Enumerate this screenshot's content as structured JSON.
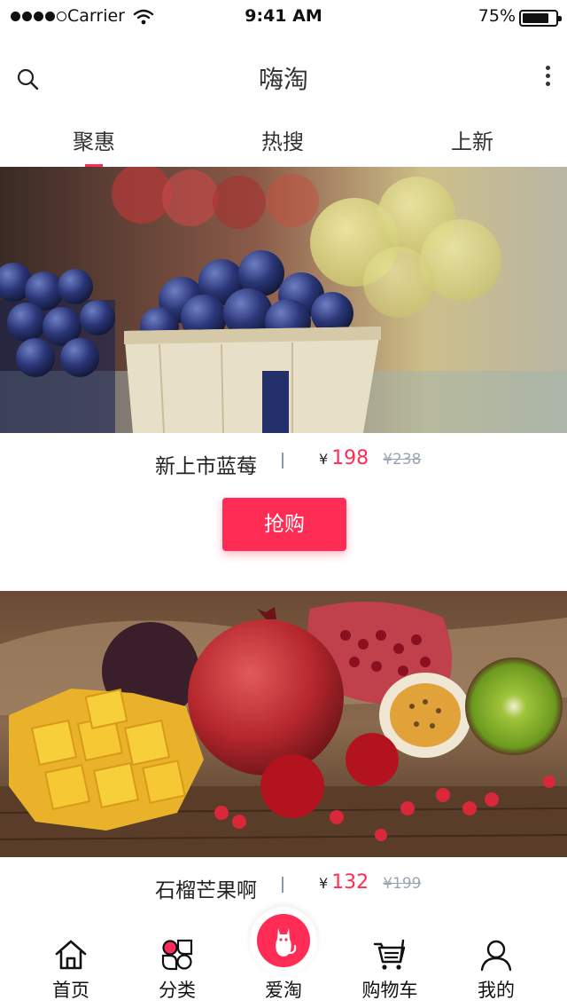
{
  "status_bar": {
    "carrier": "Carrier",
    "time": "9:41 AM",
    "battery": "75%"
  },
  "nav": {
    "title": "嗨淘"
  },
  "tabs": [
    {
      "label": "聚惠",
      "active": true
    },
    {
      "label": "热搜",
      "active": false
    },
    {
      "label": "上新",
      "active": false
    }
  ],
  "products": [
    {
      "name": "新上市蓝莓",
      "currency": "¥",
      "price": "198",
      "original_price": "¥238",
      "buy_label": "抢购"
    },
    {
      "name": "石榴芒果啊",
      "currency": "¥",
      "price": "132",
      "original_price": "¥199"
    }
  ],
  "tab_bar": {
    "items": [
      {
        "label": "首页",
        "icon": "home-icon"
      },
      {
        "label": "分类",
        "icon": "category-icon"
      },
      {
        "label": "爱淘",
        "icon": "cat-icon"
      },
      {
        "label": "购物车",
        "icon": "cart-icon"
      },
      {
        "label": "我的",
        "icon": "user-icon"
      }
    ]
  },
  "colors": {
    "accent": "#ff2d55",
    "text": "#222222",
    "muted": "#9aa6b5"
  }
}
